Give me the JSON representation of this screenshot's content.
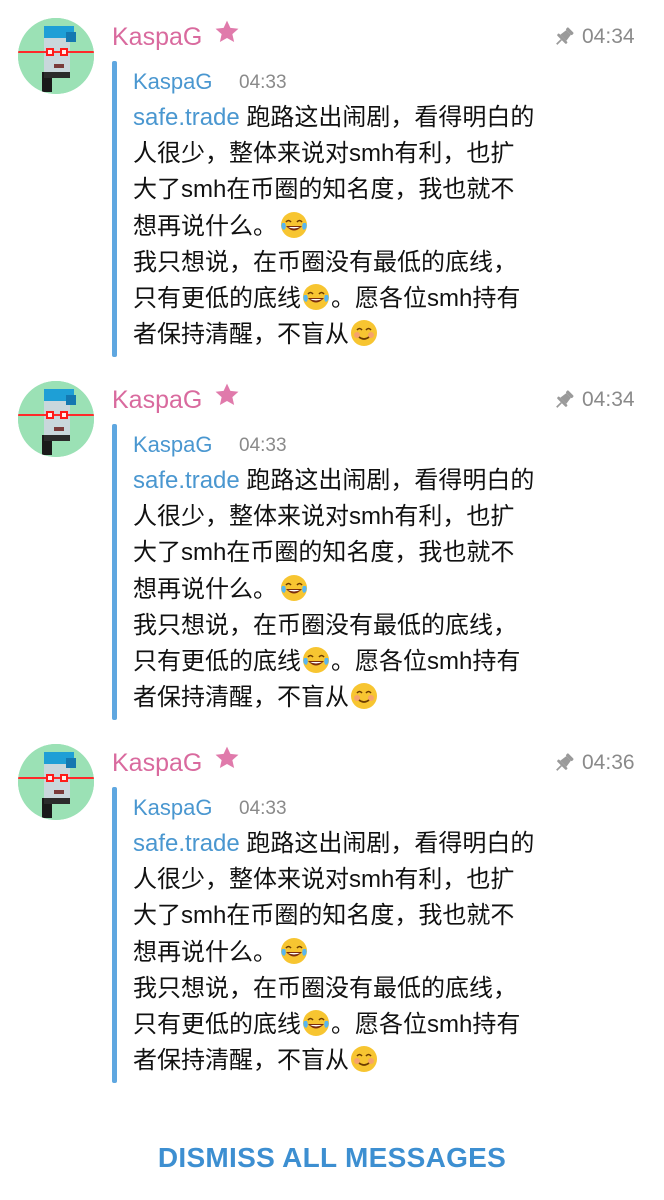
{
  "messages": [
    {
      "sender": "KaspaG",
      "time": "04:34",
      "quote": {
        "name": "KaspaG",
        "time": "04:33",
        "link": "safe.trade",
        "lines": [
          " 跑路这出闹剧，看得明白的",
          "人很少，整体来说对smh有利，也扩",
          "大了smh在币圈的知名度，我也就不",
          "想再说什么。",
          "我只想说，在币圈没有最低的底线，",
          "只有更低的底线",
          "。愿各位smh持有",
          "者保持清醒，不盲从"
        ]
      }
    },
    {
      "sender": "KaspaG",
      "time": "04:34",
      "quote": {
        "name": "KaspaG",
        "time": "04:33",
        "link": "safe.trade",
        "lines": [
          " 跑路这出闹剧，看得明白的",
          "人很少，整体来说对smh有利，也扩",
          "大了smh在币圈的知名度，我也就不",
          "想再说什么。",
          "我只想说，在币圈没有最低的底线，",
          "只有更低的底线",
          "。愿各位smh持有",
          "者保持清醒，不盲从"
        ]
      }
    },
    {
      "sender": "KaspaG",
      "time": "04:36",
      "quote": {
        "name": "KaspaG",
        "time": "04:33",
        "link": "safe.trade",
        "lines": [
          " 跑路这出闹剧，看得明白的",
          "人很少，整体来说对smh有利，也扩",
          "大了smh在币圈的知名度，我也就不",
          "想再说什么。",
          "我只想说，在币圈没有最低的底线，",
          "只有更低的底线",
          "。愿各位smh持有",
          "者保持清醒，不盲从"
        ]
      }
    }
  ],
  "icons": {
    "star": "star-icon",
    "pin": "pin-icon",
    "laugh": "tears-of-joy-emoji",
    "smile": "smiling-face-emoji"
  },
  "colors": {
    "sender": "#d96a9e",
    "link": "#4a97d0",
    "quote_bar": "#5fa7e0",
    "time": "#8a8a8a",
    "dismiss": "#3d8fd1"
  },
  "footer": {
    "dismiss_label": "DISMISS ALL MESSAGES"
  }
}
